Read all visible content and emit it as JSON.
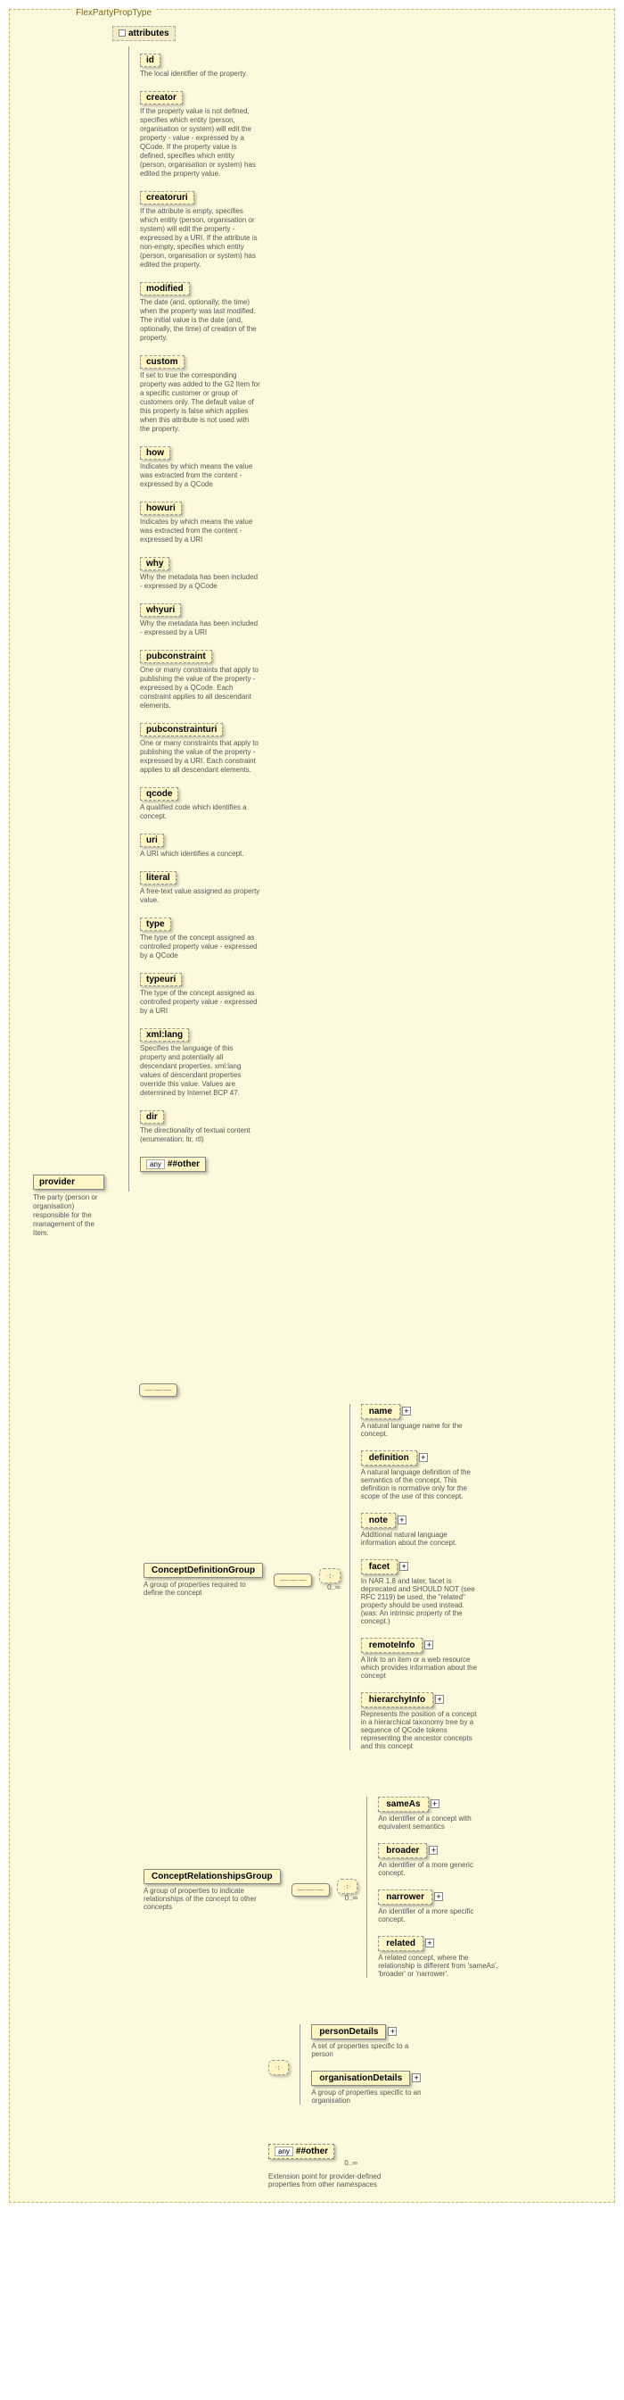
{
  "type_label": "FlexPartyPropType",
  "provider": {
    "name": "provider",
    "desc": "The party (person or organisation) responsible for the management of the Item."
  },
  "attributes_header": "attributes",
  "attrs": [
    {
      "name": "id",
      "desc": "The local identifier of the property."
    },
    {
      "name": "creator",
      "desc": "If the property value is not defined, specifies which entity (person, organisation or system) will edit the property - value - expressed by a QCode. If the property value is defined, specifies which entity (person, organisation or system) has edited the property value."
    },
    {
      "name": "creatoruri",
      "desc": "If the attribute is empty, specifies which entity (person, organisation or system) will edit the property - expressed by a URI. If the attribute is non-empty, specifies which entity (person, organisation or system) has edited the property."
    },
    {
      "name": "modified",
      "desc": "The date (and, optionally, the time) when the property was last modified. The initial value is the date (and, optionally, the time) of creation of the property."
    },
    {
      "name": "custom",
      "desc": "If set to true the corresponding property was added to the G2 Item for a specific customer or group of customers only. The default value of this property is false which applies when this attribute is not used with the property."
    },
    {
      "name": "how",
      "desc": "Indicates by which means the value was extracted from the content - expressed by a QCode"
    },
    {
      "name": "howuri",
      "desc": "Indicates by which means the value was extracted from the content - expressed by a URI"
    },
    {
      "name": "why",
      "desc": "Why the metadata has been included - expressed by a QCode"
    },
    {
      "name": "whyuri",
      "desc": "Why the metadata has been included - expressed by a URI"
    },
    {
      "name": "pubconstraint",
      "desc": "One or many constraints that apply to publishing the value of the property - expressed by a QCode. Each constraint applies to all descendant elements."
    },
    {
      "name": "pubconstrainturi",
      "desc": "One or many constraints that apply to publishing the value of the property - expressed by a URI. Each constraint applies to all descendant elements."
    },
    {
      "name": "qcode",
      "desc": "A qualified code which identifies a concept."
    },
    {
      "name": "uri",
      "desc": "A URI which identifies a concept."
    },
    {
      "name": "literal",
      "desc": "A free-text value assigned as property value."
    },
    {
      "name": "type",
      "desc": "The type of the concept assigned as controlled property value - expressed by a QCode"
    },
    {
      "name": "typeuri",
      "desc": "The type of the concept assigned as controlled property value - expressed by a URI"
    },
    {
      "name": "xml:lang",
      "desc": "Specifies the language of this property and potentially all descendant properties. xml:lang values of descendant properties override this value. Values are determined by Internet BCP 47."
    },
    {
      "name": "dir",
      "desc": "The directionality of textual content (enumeration: ltr, rtl)"
    }
  ],
  "any_other": "##other",
  "any_label": "any",
  "seq_hint": "—·—·—",
  "choice_hint": "·↕·",
  "occ_0_inf": "0..∞",
  "groups": {
    "defn": {
      "label": "ConceptDefinitionGroup",
      "desc": "A group of properties required to define the concept",
      "children": [
        {
          "name": "name",
          "desc": "A natural language name for the concept.",
          "dashed": true,
          "exp": true
        },
        {
          "name": "definition",
          "desc": "A natural language definition of the semantics of the concept. This definition is normative only for the scope of the use of this concept.",
          "dashed": true,
          "exp": true
        },
        {
          "name": "note",
          "desc": "Additional natural language information about the concept.",
          "dashed": true,
          "exp": true
        },
        {
          "name": "facet",
          "desc": "In NAR 1.8 and later, facet is deprecated and SHOULD NOT (see RFC 2119) be used, the \"related\" property should be used instead. (was: An intrinsic property of the concept.)",
          "dashed": true,
          "exp": true
        },
        {
          "name": "remoteInfo",
          "desc": "A link to an item or a web resource which provides information about the concept",
          "dashed": true,
          "exp": true
        },
        {
          "name": "hierarchyInfo",
          "desc": "Represents the position of a concept in a hierarchical taxonomy tree by a sequence of QCode tokens representing the ancestor concepts and this concept",
          "dashed": true,
          "exp": true
        }
      ]
    },
    "rel": {
      "label": "ConceptRelationshipsGroup",
      "desc": "A group of properties to indicate relationships of the concept to other concepts",
      "children": [
        {
          "name": "sameAs",
          "desc": "An identifier of a concept with equivalent semantics",
          "dashed": true,
          "exp": true
        },
        {
          "name": "broader",
          "desc": "An identifier of a more generic concept.",
          "dashed": true,
          "exp": true
        },
        {
          "name": "narrower",
          "desc": "An identifier of a more specific concept.",
          "dashed": true,
          "exp": true
        },
        {
          "name": "related",
          "desc": "A related concept, where the relationship is different from 'sameAs', 'broader' or 'narrower'.",
          "dashed": true,
          "exp": true
        }
      ]
    },
    "choice": [
      {
        "name": "personDetails",
        "desc": "A set of properties specific to a person",
        "exp": true
      },
      {
        "name": "organisationDetails",
        "desc": "A group of properties specific to an organisation",
        "exp": true
      }
    ],
    "ext": {
      "label": "##other",
      "desc": "Extension point for provider-defined properties from other namespaces"
    }
  }
}
